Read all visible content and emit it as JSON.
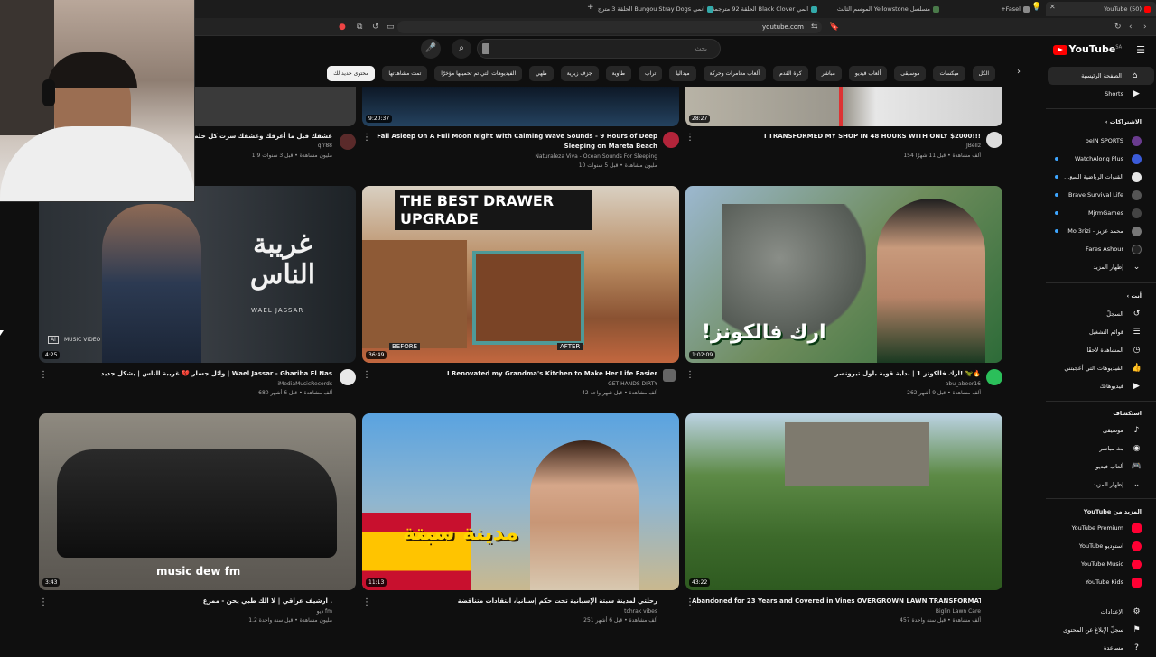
{
  "browser": {
    "tabs": [
      {
        "label": "(50) YouTube",
        "active": true
      },
      {
        "label": "Fasel+",
        "active": false
      },
      {
        "label": "مسلسل Yellowstone الموسم الثالث",
        "active": false
      },
      {
        "label": "انمي Black Clover الحلقة 92 مترجمة او",
        "active": false
      },
      {
        "label": "انمي Bungou Stray Dogs الحلقة 3 مترج",
        "active": false
      }
    ],
    "url": "youtube.com"
  },
  "header": {
    "search_placeholder": "بحث",
    "logo_text": "YouTube",
    "logo_region": "SA"
  },
  "chips": [
    {
      "label": "الكل",
      "active": false
    },
    {
      "label": "ميكسات",
      "active": false
    },
    {
      "label": "موسيقى",
      "active": false
    },
    {
      "label": "ألعاب فيديو",
      "active": false
    },
    {
      "label": "مباشر",
      "active": false
    },
    {
      "label": "كرة القدم",
      "active": false
    },
    {
      "label": "ألعاب مغامرات وحركة",
      "active": false
    },
    {
      "label": "ميداليا",
      "active": false
    },
    {
      "label": "تراب",
      "active": false
    },
    {
      "label": "طاوية",
      "active": false
    },
    {
      "label": "جزف زيرية",
      "active": false
    },
    {
      "label": "طهي",
      "active": false
    },
    {
      "label": "الفيديوهات التي تم تحميلها مؤخرًا",
      "active": false
    },
    {
      "label": "تمت مشاهدتها",
      "active": false
    },
    {
      "label": "محتوى جديد لك",
      "active": true
    }
  ],
  "sidebar": {
    "main": [
      {
        "label": "الصفحة الرئيسية",
        "icon": "home-icon",
        "active": true
      },
      {
        "label": "Shorts",
        "icon": "shorts-icon",
        "active": false
      }
    ],
    "subscriptions_title": "الاشتراكات",
    "subscriptions": [
      {
        "label": "beIN SPORTS",
        "color": "#6a3b8f",
        "dot": false
      },
      {
        "label": "WatchAlong Plus",
        "color": "#3b5bd9",
        "dot": true
      },
      {
        "label": "القنوات الرياضية السع...",
        "color": "#e6e6e6",
        "dot": true
      },
      {
        "label": "Brave Survival Life",
        "color": "#555",
        "dot": true
      },
      {
        "label": "MjrmGames",
        "color": "#444",
        "dot": false
      },
      {
        "label": "محمد عزيز - Mo 3rizi",
        "color": "#777",
        "dot": true
      },
      {
        "label": "Fares Ashour",
        "color": "#222",
        "dot": false
      }
    ],
    "show_more_subs": "إظهار المزيد",
    "you_title": "أنت",
    "you_items": [
      {
        "label": "السجلّ",
        "icon": "history-icon"
      },
      {
        "label": "قوائم التشغيل",
        "icon": "playlist-icon"
      },
      {
        "label": "المشاهدة لاحقًا",
        "icon": "clock-icon"
      },
      {
        "label": "الفيديوهات التي أعجبتني",
        "icon": "like-icon"
      },
      {
        "label": "فيديوهاتك",
        "icon": "your-videos-icon"
      }
    ],
    "explore_title": "استكشاف",
    "explore_items": [
      {
        "label": "موسيقى",
        "icon": "music-icon"
      },
      {
        "label": "بث مباشر",
        "icon": "live-icon"
      },
      {
        "label": "ألعاب فيديو",
        "icon": "gaming-icon"
      },
      {
        "label": "إظهار المزيد",
        "icon": "chevron-down-icon"
      }
    ],
    "more_title": "المزيد من YouTube",
    "more_items": [
      {
        "label": "YouTube Premium",
        "color": "#ff0033"
      },
      {
        "label": "استوديو YouTube",
        "color": "#ff0033"
      },
      {
        "label": "YouTube Music",
        "color": "#ff0033"
      },
      {
        "label": "YouTube Kids",
        "color": "#ff0033"
      }
    ],
    "settings_items": [
      {
        "label": "الإعدادات",
        "icon": "gear-icon"
      },
      {
        "label": "سجلّ الإبلاغ عن المحتوى",
        "icon": "flag-icon"
      },
      {
        "label": "مساعدة",
        "icon": "help-icon"
      }
    ]
  },
  "videos": [
    {
      "title": "عشقك قبل ما أعرفك وعشقك سرت كل حلم عيادي",
      "channel": "qrr88",
      "meta": "1.9 مليون مشاهدة • قبل 3 سنوات",
      "duration": "",
      "thumb": "#3a3a3a",
      "avatar": "#5a2a2a"
    },
    {
      "title": "Fall Asleep On A Full Moon Night With Calming Wave Sounds - 9 Hours of Deep",
      "title2": "Sleeping on Mareta Beach",
      "channel": "Naturaleza Viva - Ocean Sounds For Sleeping",
      "meta": "10 مليون مشاهدة • قبل 5 سنوات",
      "duration": "9:20:37",
      "thumb": "#1c2b40",
      "avatar": "#b2243a"
    },
    {
      "title": "I TRANSFORMED MY SHOP IN 48 HOURS WITH ONLY $2000!!!",
      "channel": "JBellz",
      "meta": "154 ألف مشاهدة • قبل 11 شهرًا",
      "duration": "28:27",
      "thumb": "#7f8a8c",
      "avatar": "#ddd"
    },
    {
      "title": "وائل جسار 💔 غريبة الناس | بشكل جديد | Wael Jassar - Ghariba El Nas",
      "channel": "iMediaMusicRecords",
      "meta": "680 ألف مشاهدة • قبل 6 أشهر",
      "duration": "4:25",
      "thumb": "#2a2f33",
      "avatar": "#e8e8e8",
      "overlay": "غريبة الناس",
      "sub": "WAEL JASSAR",
      "badge": "MUSIC VIDEO"
    },
    {
      "title": "I Renovated my Grandma's Kitchen to Make Her Life Easier",
      "channel": "GET HANDS DIRTY",
      "meta": "42 ألف مشاهدة • قبل شهر واحد",
      "duration": "36:49",
      "thumb": "#7a4a2e",
      "avatar": "#666",
      "overlay": "THE BEST DRAWER UPGRADE",
      "before": "BEFORE",
      "after": "AFTER"
    },
    {
      "title": "ارك فالكونز 1 | بداية قوية بلول تيرونصر! 🦖🔥",
      "channel": "abu_abeer16",
      "meta": "262 ألف مشاهدة • قبل 9 أشهر",
      "duration": "1:02:09",
      "thumb": "#2f6f3a",
      "avatar": "#2bbf5a",
      "overlay": "ارك فالكونز!"
    },
    {
      "title": "ارشيف عراقي | لا الك طبي يحن - ممرع .",
      "channel": "ديو fm",
      "meta": "1.2 مليون مشاهدة • قبل سنة واحدة",
      "duration": "3:43",
      "thumb": "#6d6a63",
      "avatar": "#333",
      "overlay": "music dew fm"
    },
    {
      "title": "رحلتي لمدينة سبتة الإسبانية تحت حكم إسبانيا، انتقادات متناقضة",
      "channel": "tchrak vibes",
      "meta": "251 ألف مشاهدة • قبل 6 أشهر",
      "duration": "11:13",
      "thumb": "#4d8fc9",
      "avatar": "#888",
      "overlay": "مدينة سبتة"
    },
    {
      "title": "Abandoned for 23 Years and Covered in Vines  OVERGROWN LAWN TRANSFORMATION",
      "channel": "Biglin Lawn Care",
      "meta": "457 ألف مشاهدة • قبل سنة واحدة",
      "duration": "43:22",
      "thumb": "#3d6a2b",
      "avatar": "#555"
    }
  ]
}
